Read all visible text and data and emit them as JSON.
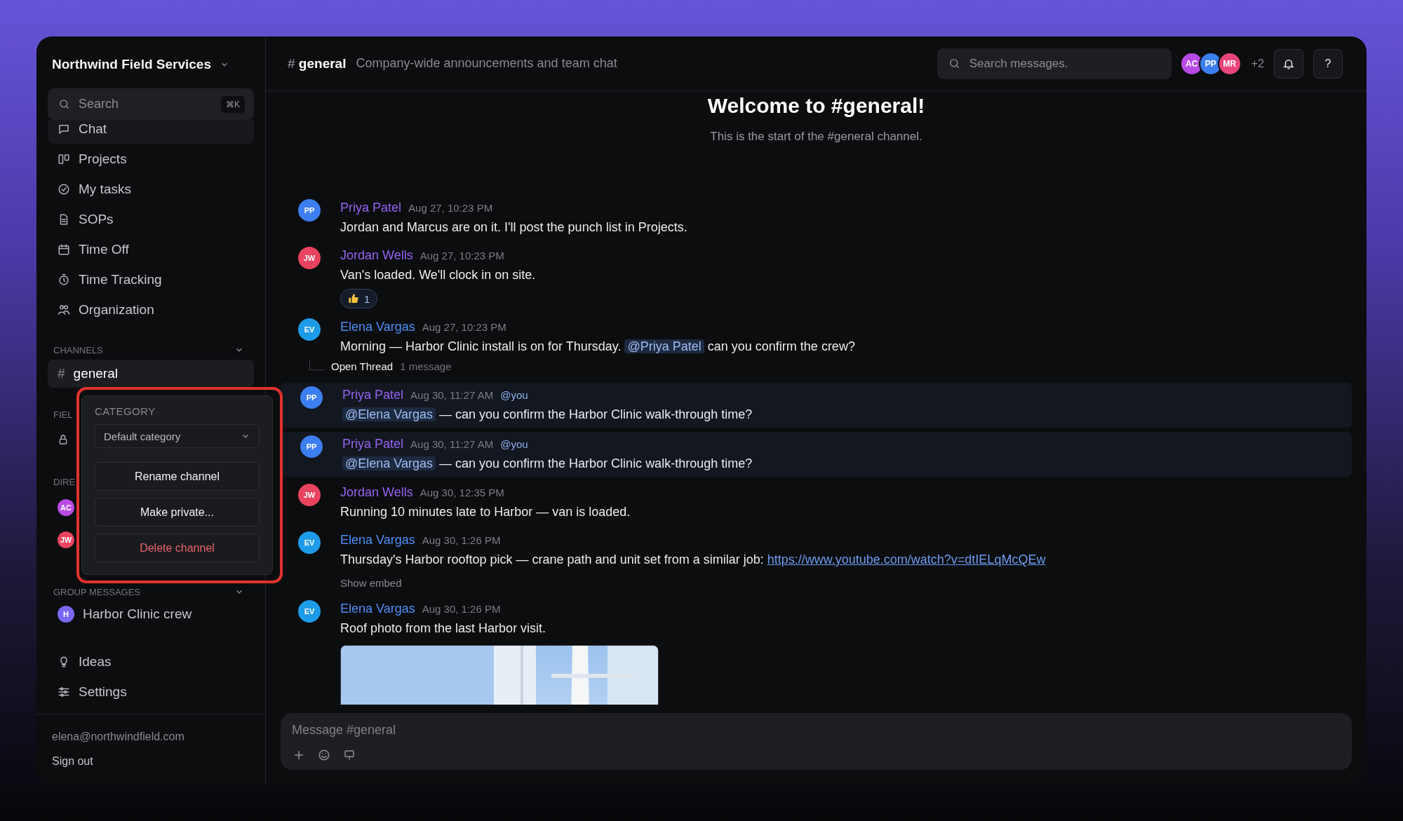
{
  "sidebar": {
    "workspace": "Northwind Field Services",
    "search": {
      "placeholder": "Search",
      "shortcut": "⌘K"
    },
    "nav": [
      {
        "kind": "chat",
        "label": "Chat",
        "selected": true
      },
      {
        "kind": "board",
        "label": "Projects",
        "selected": false
      },
      {
        "kind": "check",
        "label": "My tasks",
        "selected": false
      },
      {
        "kind": "document",
        "label": "SOPs",
        "selected": false
      },
      {
        "kind": "calendar",
        "label": "Time Off",
        "selected": false
      },
      {
        "kind": "stopwatch",
        "label": "Time Tracking",
        "selected": false
      },
      {
        "kind": "people",
        "label": "Organization",
        "selected": false
      }
    ],
    "channels": {
      "title": "CHANNELS",
      "expanded": true,
      "items": [
        {
          "prefix": "#",
          "name": "general",
          "selected": true
        }
      ]
    },
    "field_section": {
      "title": "FIEL",
      "items": [
        {
          "private": true
        }
      ]
    },
    "direct_messages": {
      "title": "DIRE",
      "items": [
        {
          "initials": "AC",
          "color": "#b84ae6"
        },
        {
          "initials": "JW",
          "color": "#e8435f"
        }
      ]
    },
    "group_messages": {
      "title": "GROUP MESSAGES",
      "expanded": true,
      "items": [
        {
          "initials": "H",
          "name": "Harbor Clinic crew",
          "color": "#7b68f2"
        }
      ]
    },
    "bottom_nav": [
      {
        "kind": "bulb",
        "label": "Ideas"
      },
      {
        "kind": "sliders",
        "label": "Settings"
      }
    ],
    "account": {
      "email": "elena@northwindfield.com",
      "sign_out": "Sign out"
    }
  },
  "header": {
    "prefix": "#",
    "channel": "general",
    "description": "Company-wide announcements and team chat",
    "search_placeholder": "Search messages.",
    "members": [
      {
        "initials": "AC",
        "color": "#b84ae6"
      },
      {
        "initials": "PP",
        "color": "#3d7ef0"
      },
      {
        "initials": "MR",
        "color": "#e8457d"
      }
    ],
    "more_members": "+2",
    "help": "?"
  },
  "welcome": {
    "title": "Welcome to #general!",
    "subtitle": "This is the start of the #general channel."
  },
  "messages": [
    {
      "initials": "PP",
      "color": "#3d7ef0",
      "author": "Priya Patel",
      "own": false,
      "time": "Aug 27, 10:23 PM",
      "highlighted": false,
      "parts": [
        {
          "kind": "text",
          "text": "Jordan and Marcus are on it. I'll post the punch list in Projects."
        }
      ]
    },
    {
      "initials": "JW",
      "color": "#e8435f",
      "author": "Jordan Wells",
      "own": false,
      "time": "Aug 27, 10:23 PM",
      "highlighted": false,
      "parts": [
        {
          "kind": "text",
          "text": "Van's loaded. We'll clock in on site."
        }
      ],
      "reactions": [
        {
          "kind": "thumbs_up",
          "count": "1"
        }
      ]
    },
    {
      "initials": "EV",
      "color": "#1e9be8",
      "author": "Elena Vargas",
      "own": true,
      "time": "Aug 27, 10:23 PM",
      "highlighted": false,
      "parts": [
        {
          "kind": "text",
          "text": "Morning — Harbor Clinic install is on for Thursday. "
        },
        {
          "kind": "mention",
          "text": "@Priya Patel"
        },
        {
          "kind": "text",
          "text": " can you confirm the crew?"
        }
      ],
      "thread": {
        "label": "Open Thread",
        "count": "1 message"
      }
    },
    {
      "initials": "PP",
      "color": "#3d7ef0",
      "author": "Priya Patel",
      "own": false,
      "time": "Aug 30, 11:27 AM",
      "tag": "@you",
      "highlighted": true,
      "parts": [
        {
          "kind": "mention",
          "text": "@Elena Vargas"
        },
        {
          "kind": "text",
          "text": " — can you confirm the Harbor Clinic walk-through time?"
        }
      ]
    },
    {
      "initials": "PP",
      "color": "#3d7ef0",
      "author": "Priya Patel",
      "own": false,
      "time": "Aug 30, 11:27 AM",
      "tag": "@you",
      "highlighted": true,
      "parts": [
        {
          "kind": "mention",
          "text": "@Elena Vargas"
        },
        {
          "kind": "text",
          "text": " — can you confirm the Harbor Clinic walk-through time?"
        }
      ]
    },
    {
      "initials": "JW",
      "color": "#e8435f",
      "author": "Jordan Wells",
      "own": false,
      "time": "Aug 30, 12:35 PM",
      "highlighted": false,
      "parts": [
        {
          "kind": "text",
          "text": "Running 10 minutes late to Harbor — van is loaded."
        }
      ]
    },
    {
      "initials": "EV",
      "color": "#1e9be8",
      "author": "Elena Vargas",
      "own": true,
      "time": "Aug 30, 1:26 PM",
      "highlighted": false,
      "parts": [
        {
          "kind": "text",
          "text": "Thursday's Harbor rooftop pick — crane path and unit set from a similar job: "
        },
        {
          "kind": "link",
          "text": "https://www.youtube.com/watch?v=dtIELqMcQEw"
        }
      ],
      "embed_toggle": "Show embed"
    },
    {
      "initials": "EV",
      "color": "#1e9be8",
      "author": "Elena Vargas",
      "own": true,
      "time": "Aug 30, 1:26 PM",
      "highlighted": false,
      "parts": [
        {
          "kind": "text",
          "text": "Roof photo from the last Harbor visit."
        }
      ],
      "attachment": {
        "kind": "picture"
      }
    }
  ],
  "composer": {
    "placeholder": "Message #general",
    "tools": [
      {
        "kind": "plus"
      },
      {
        "kind": "emoji"
      },
      {
        "kind": "sign"
      }
    ]
  },
  "channel_menu": {
    "title": "CATEGORY",
    "select": {
      "value": "Default category"
    },
    "actions": [
      {
        "label": "Rename channel",
        "danger": false
      },
      {
        "label": "Make private...",
        "danger": false
      },
      {
        "label": "Delete channel",
        "danger": true
      }
    ]
  }
}
